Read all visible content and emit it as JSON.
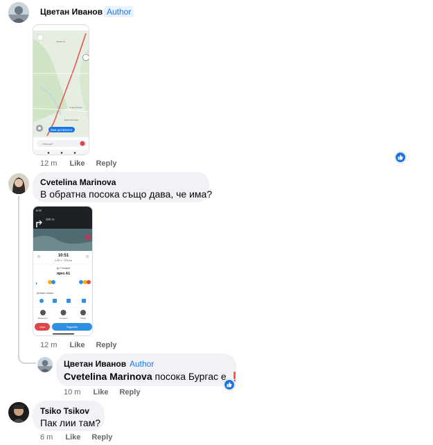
{
  "comments": [
    {
      "author": "Цветан Иванов",
      "badge": "Author",
      "time": "12 m",
      "like_label": "Like",
      "reply_label": "Reply",
      "map_screenshot": {
        "chip_label": "Виж детайлите",
        "search_placeholder": "Накъде?",
        "place_labels": [
          "Казанлък",
          "Стара Загора",
          "Димитровград"
        ]
      }
    },
    {
      "author": "Cvetelina Marinova",
      "text": "В обратна посока също дава, че има?",
      "time": "12 m",
      "like_label": "Like",
      "reply_label": "Reply",
      "nav_screenshot": {
        "status_time": "8:25",
        "distance": "300 m",
        "eta": "10:51",
        "eta_sub": "2:26 ч. · 276 km",
        "to": "До Пловдив",
        "via": "през А1",
        "add_stop": "Добави спирка",
        "bottom_labels": [
          "Маршрути",
          "Сподели",
          "Обзор"
        ],
        "stop_button": "Спри",
        "go_button": "Подробно"
      }
    },
    {
      "author": "Цветан Иванов",
      "badge": "Author",
      "mention": "Cvetelina Marinova",
      "text": "посока Бургас е",
      "exclaim": "❗",
      "time": "10 m",
      "like_label": "Like",
      "reply_label": "Reply"
    },
    {
      "author": "Tsiko Tsikov",
      "text": "Пак лии там?",
      "time": "6 m",
      "like_label": "Like",
      "reply_label": "Reply"
    }
  ],
  "colors": {
    "accent": "#1b74e4",
    "bubble": "#f0f2f5",
    "meta": "#65676b"
  }
}
